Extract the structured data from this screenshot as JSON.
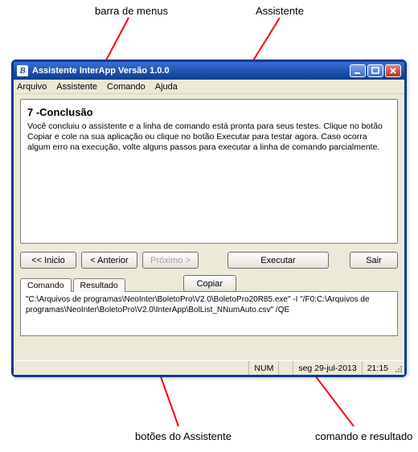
{
  "annotations": {
    "menubar": "barra de menus",
    "assistant": "Assistente",
    "buttons": "botões do Assistente",
    "command": "comando e resultado"
  },
  "window": {
    "title": "Assistente InterApp Versão 1.0.0",
    "icon_letter": "B"
  },
  "menubar": {
    "arquivo": "Arquivo",
    "assistente": "Assistente",
    "comando": "Comando",
    "ajuda": "Ajuda"
  },
  "panel": {
    "title": "7 -Conclusão",
    "body": "Você concluiu o assistente e a linha de comando está pronta para seus testes. Clique no botão Copiar e cole na sua aplicação ou clique no botão Executar para testar agora. Caso ocorra algum erro na execução, volte alguns passos para executar a linha de comando parcialmente."
  },
  "buttons": {
    "inicio": "<< Inicio",
    "anterior": "< Anterior",
    "proximo": "Próximo >",
    "executar": "Executar",
    "sair": "Sair",
    "copiar": "Copiar"
  },
  "tabs": {
    "comando": "Comando",
    "resultado": "Resultado"
  },
  "command_text": "\"C:\\Arquivos de programas\\NeoInter\\BoletoPro\\V2.0\\BoletoPro20R85.exe\" -I \"/F0:C:\\Arquivos de programas\\NeoInter\\BoletoPro\\V2.0\\InterApp\\BolList_NNumAuto.csv\" /QE",
  "statusbar": {
    "num": "NUM",
    "date": "seg 29-jul-2013",
    "time": "21:15"
  }
}
